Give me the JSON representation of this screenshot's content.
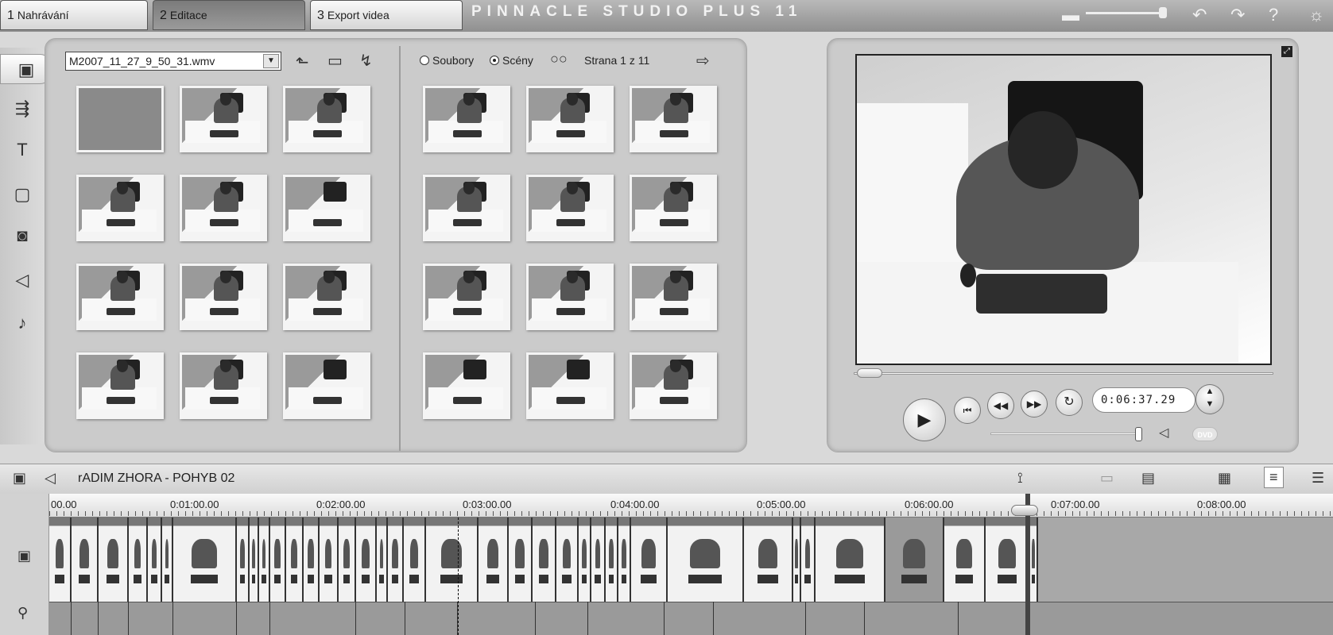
{
  "tabs": [
    {
      "num": "1",
      "label": "Nahrávání"
    },
    {
      "num": "2",
      "label": "Editace"
    },
    {
      "num": "3",
      "label": "Export videa"
    }
  ],
  "brand": "PINNACLE STUDIO PLUS 11",
  "album": {
    "file": "M2007_11_27_9_50_31.wmv",
    "radio_files": "Soubory",
    "radio_scenes": "Scény",
    "page": "Strana 1 z 11"
  },
  "player": {
    "timecode": "0:06:37.29",
    "dvd_label": "DVD"
  },
  "timeline": {
    "title": "rADIM ZHORA - POHYB 02",
    "ruler": [
      "00.00",
      "0:01:00.00",
      "0:02:00.00",
      "0:03:00.00",
      "0:04:00.00",
      "0:05:00.00",
      "0:06:00.00",
      "0:07:00.00",
      "0:08:00.00"
    ]
  }
}
